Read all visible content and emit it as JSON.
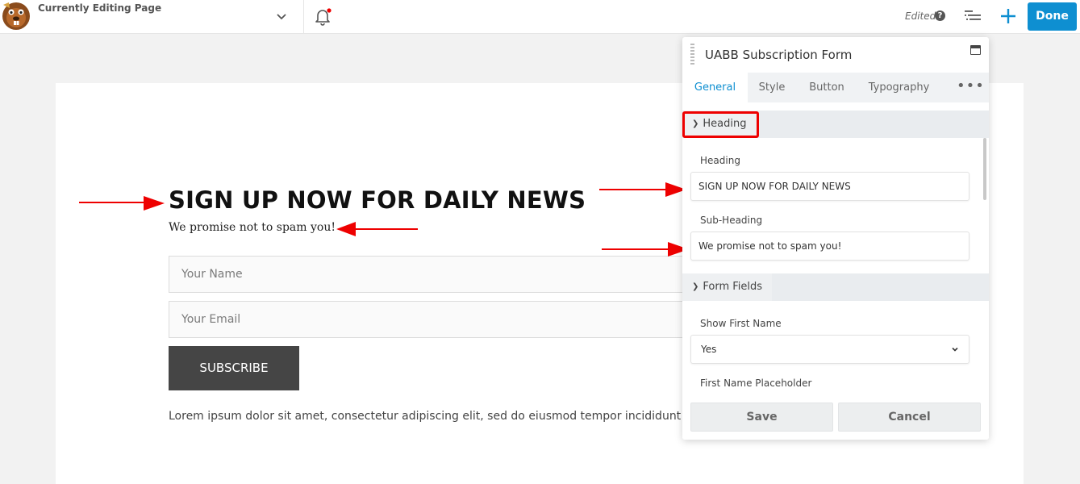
{
  "topbar": {
    "page_label": "Currently Editing Page",
    "status": "Edited",
    "help_glyph": "?",
    "done_label": "Done",
    "accent": "#0e8fd1"
  },
  "canvas": {
    "title": "SIGN UP NOW FOR DAILY NEWS",
    "subtitle": "We promise not to spam you!",
    "name_placeholder": "Your Name",
    "email_placeholder": "Your Email",
    "subscribe_label": "SUBSCRIBE",
    "lorem": "Lorem ipsum dolor sit amet, consectetur adipiscing elit, sed do eiusmod tempor incididunt ut labore et dolore magna aliqua."
  },
  "panel": {
    "title": "UABB Subscription Form",
    "tabs": [
      "General",
      "Style",
      "Button",
      "Typography"
    ],
    "active_tab": "General",
    "more_glyph": "•••",
    "sections": {
      "heading": {
        "title": "Heading",
        "heading_label": "Heading",
        "heading_value": "SIGN UP NOW FOR DAILY NEWS",
        "subheading_label": "Sub-Heading",
        "subheading_value": "We promise not to spam you!"
      },
      "form_fields": {
        "title": "Form Fields",
        "show_first_name_label": "Show First Name",
        "show_first_name_value": "Yes",
        "first_name_placeholder_label": "First Name Placeholder"
      }
    },
    "save_label": "Save",
    "cancel_label": "Cancel"
  },
  "icons": {
    "logo": "beaver-logo-icon",
    "chevron": "chevron-down-icon",
    "bell": "bell-icon",
    "help": "question-icon",
    "outline": "outline-list-icon",
    "add": "plus-icon",
    "annotation": "arrow-icon"
  }
}
